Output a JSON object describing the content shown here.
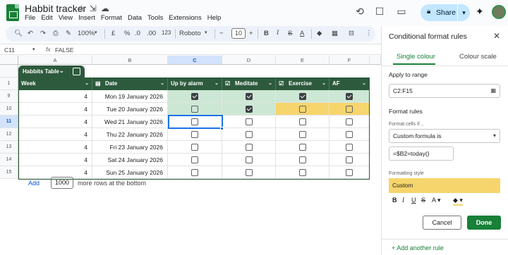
{
  "titlebar": {
    "doc_title": "Habbit tracker",
    "menu": [
      "File",
      "Edit",
      "View",
      "Insert",
      "Format",
      "Data",
      "Tools",
      "Extensions",
      "Help"
    ],
    "share_label": "Share",
    "accent": "#c2e7ff"
  },
  "toolbar": {
    "zoom": "100%",
    "currency": "£",
    "percent": "%",
    "dec_minus": ".0",
    "dec_plus": ".00",
    "number_format": "123",
    "font": "Roboto",
    "font_size": "10",
    "minus": "−",
    "plus": "+"
  },
  "formula_bar": {
    "cell_ref": "C11",
    "fx": "fx",
    "value": "FALSE"
  },
  "sheet": {
    "columns": [
      "A",
      "B",
      "C",
      "D",
      "E",
      "F"
    ],
    "rows": [
      "1",
      "9",
      "10",
      "11",
      "12",
      "13",
      "14",
      "15"
    ],
    "table_name": "Habbits Table",
    "headers": [
      "Week",
      "Date",
      "Up by alarm",
      "Meditate",
      "Exercise",
      "AF"
    ],
    "data_rows": [
      {
        "week": "4",
        "date": "Mon 19 January 2026",
        "checks": [
          true,
          true,
          true,
          true
        ]
      },
      {
        "week": "4",
        "date": "Tue 20 January 2026",
        "checks": [
          false,
          true,
          false,
          false
        ]
      },
      {
        "week": "4",
        "date": "Wed 21 January 2026",
        "checks": [
          false,
          false,
          false,
          false
        ]
      },
      {
        "week": "4",
        "date": "Thu 22 January 2026",
        "checks": [
          false,
          false,
          false,
          false
        ]
      },
      {
        "week": "4",
        "date": "Fri 23 January 2026",
        "checks": [
          false,
          false,
          false,
          false
        ]
      },
      {
        "week": "4",
        "date": "Sat 24 January 2026",
        "checks": [
          false,
          false,
          false,
          false
        ]
      },
      {
        "week": "4",
        "date": "Sun 25 January 2026",
        "checks": [
          false,
          false,
          false,
          false
        ]
      }
    ],
    "add_label": "Add",
    "add_count": "1000",
    "add_suffix": "more rows at the bottom",
    "colors": {
      "header": "#2d5a3d",
      "green": "#cde7d5",
      "yellow": "#f6d56c"
    }
  },
  "panel": {
    "title": "Conditional format rules",
    "tab_single": "Single colour",
    "tab_scale": "Colour scale",
    "apply_label": "Apply to range",
    "range": "C2:F15",
    "format_rules_label": "Format rules",
    "format_cells_if": "Format cells if...",
    "condition": "Custom formula is",
    "formula": "=$B2=today()",
    "formatting_style_label": "Formatting style",
    "style_name": "Custom",
    "style_color": "#f6d56c",
    "cancel": "Cancel",
    "done": "Done",
    "add_rule": "+ Add another rule"
  }
}
